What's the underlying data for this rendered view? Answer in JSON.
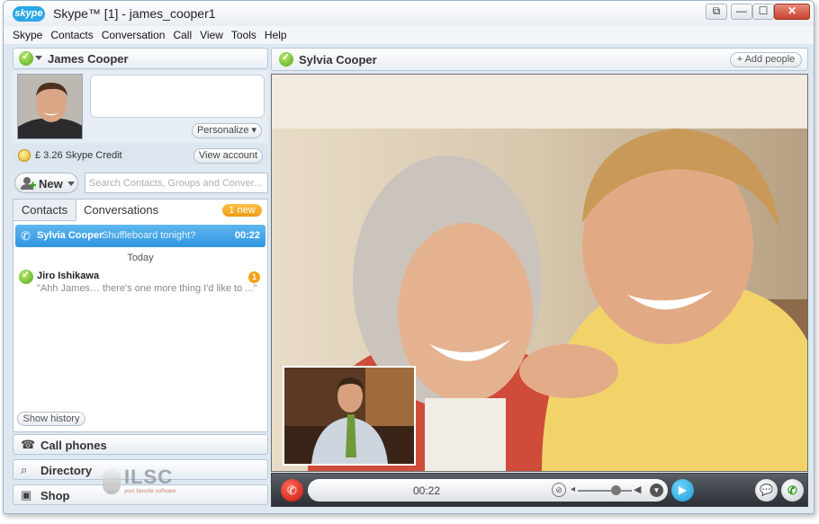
{
  "window": {
    "title": "Skype™ [1] - james_cooper1",
    "logo_text": "skype",
    "buttons": {
      "restore": "⧉",
      "minimize": "—",
      "maximize": "☐",
      "close": "✕"
    }
  },
  "menu": [
    "Skype",
    "Contacts",
    "Conversation",
    "Call",
    "View",
    "Tools",
    "Help"
  ],
  "profile": {
    "name": "James Cooper",
    "status_icon": "online-status-icon",
    "personalize_label": "Personalize ▾",
    "credit_text": "£ 3.26 Skype Credit",
    "view_account_label": "View account"
  },
  "toolbar": {
    "new_label": "New",
    "search_placeholder": "Search Contacts, Groups and Conver..."
  },
  "tabs": {
    "contacts": "Contacts",
    "conversations": "Conversations",
    "new_badge": "1 new"
  },
  "conversations": {
    "active": {
      "name": "Sylvia Cooper",
      "message": "Shuffleboard tonight?",
      "time": "00:22"
    },
    "group_label": "Today",
    "items": [
      {
        "name": "Jiro Ishikawa",
        "message": "\"Ahh James… there's one more thing I'd like to ...\"",
        "unread": "1"
      }
    ],
    "show_history_label": "Show history"
  },
  "side_nav": {
    "call_phones": "Call phones",
    "directory": "Directory",
    "shop": "Shop"
  },
  "watermark": {
    "text": "ILSC",
    "subtext": "your favorite software"
  },
  "call": {
    "contact_name": "Sylvia Cooper",
    "add_people_label": "+ Add people",
    "timer": "00:22"
  },
  "colors": {
    "accent_blue": "#2f96e0",
    "online_green": "#52a51e",
    "badge_orange": "#f09b10",
    "end_call_red": "#c8140a"
  }
}
